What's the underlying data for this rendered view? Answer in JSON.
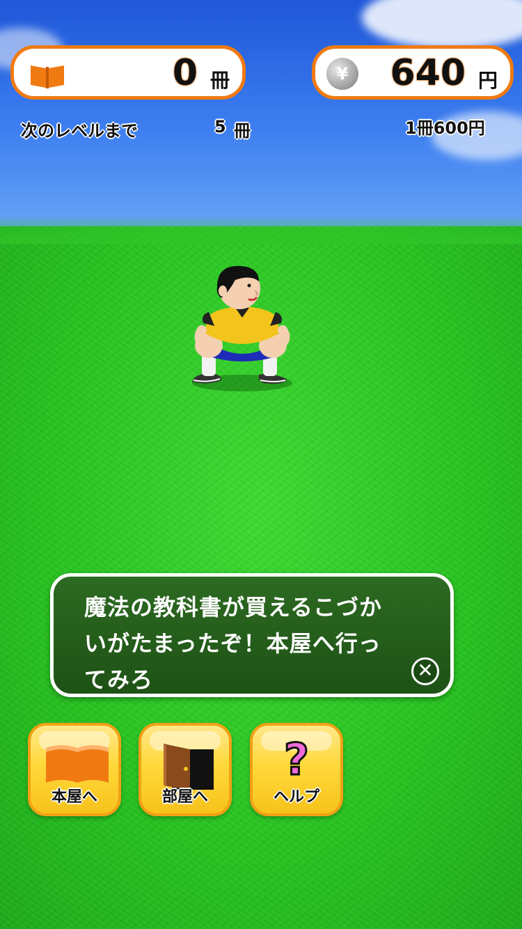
{
  "hud": {
    "books": {
      "value": "0",
      "unit": "冊"
    },
    "money": {
      "value": "640",
      "unit": "円",
      "coin_symbol": "¥"
    },
    "next_level_label": "次のレベルまで",
    "next_level_value": "5",
    "next_level_unit": "冊",
    "price_label": "1冊600円"
  },
  "message": {
    "text": "魔法の教科書が買えるこづか\nいがたまったぞ！本屋へ行っ\nてみろ",
    "close_symbol": "✕"
  },
  "menu": {
    "bookstore_label": "本屋へ",
    "room_label": "部屋へ",
    "help_label": "ヘルプ",
    "help_symbol": "?"
  },
  "colors": {
    "accent_orange": "#f07a12",
    "button_yellow": "#ffd93a",
    "message_bg": "#1e5216",
    "help_pink": "#f06ad8"
  },
  "icons": {
    "books": "open-book-icon",
    "money": "yen-coin-icon",
    "close": "close-icon",
    "bookstore": "open-book-icon",
    "room": "door-icon",
    "help": "question-mark-icon"
  }
}
